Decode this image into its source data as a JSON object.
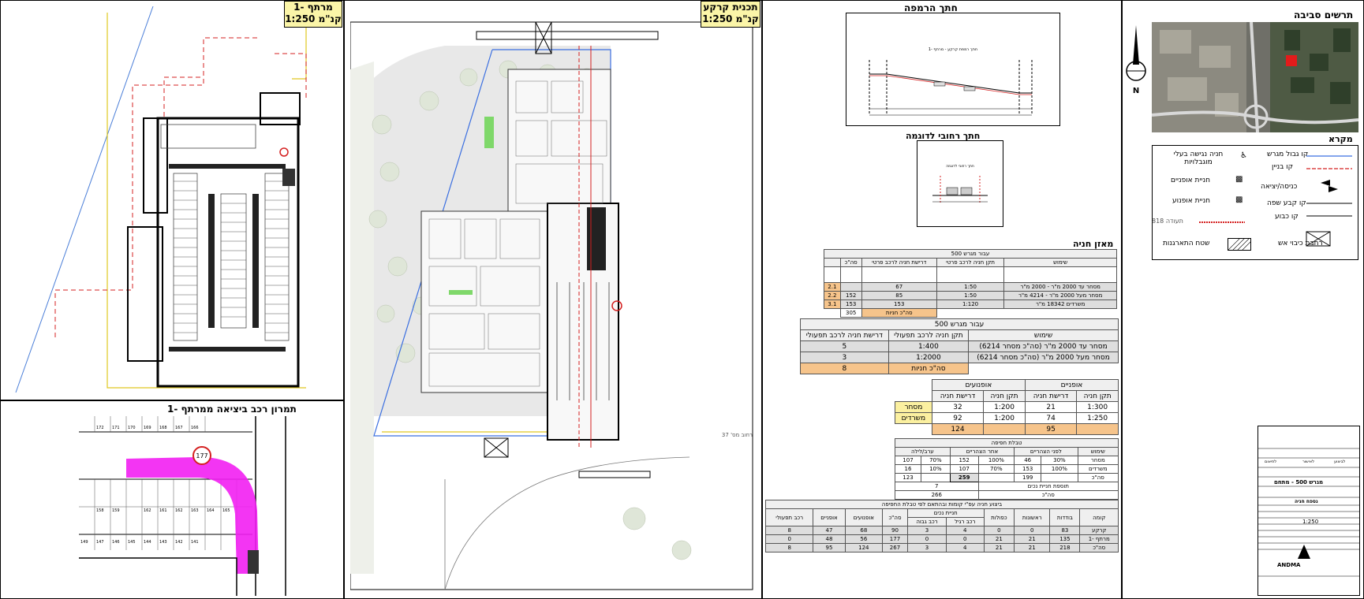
{
  "panels": {
    "basement_plan": {
      "title_line1": "מרתף -1",
      "title_line2": "קנ\"מ 1:250"
    },
    "ground_plan": {
      "title_line1": "תכנית קרקע",
      "title_line2": "קנ\"מ 1:250",
      "street_label": "רחוב מס' 37"
    },
    "turning": {
      "title": "תמרון רכב ביציאה ממרתף -1",
      "bay_numbers": [
        "172",
        "171",
        "170",
        "169",
        "168",
        "167",
        "166",
        "158",
        "159",
        "162",
        "161",
        "162",
        "163",
        "164",
        "165",
        "149",
        "147",
        "146",
        "145",
        "144",
        "143",
        "142",
        "141"
      ],
      "circle_label": "177"
    },
    "ramp_section": {
      "title": "חתך הרמפה",
      "inner_label": "חתך רמפת קרקע - מרתף -1"
    },
    "street_section": {
      "title": "חתך רחובי לדוגמה",
      "inner_label": "חתך רחובי לדוגמה"
    },
    "environs": {
      "title": "תרשים סביבה"
    }
  },
  "legend": {
    "title": "מקרא",
    "items": [
      {
        "label": "קו גבול מגרש",
        "color": "#3b6fe0"
      },
      {
        "label": "קו בניין",
        "color": "#d42020"
      },
      {
        "label": "כניסה/יציאה",
        "color": "#000000"
      },
      {
        "label": "קו קבע שפה",
        "color": "#000000"
      },
      {
        "label": "קו כבוע",
        "color": "#000000"
      },
      {
        "label": "חניה נגישה בעלי מוגבלויות",
        "color": "#000000"
      },
      {
        "label": "חניית אופניים",
        "color": "#000000"
      },
      {
        "label": "חניית אופנוע",
        "color": "#000000"
      },
      {
        "label": "תעודה 818",
        "color": "#d42020"
      },
      {
        "label": "רחבת כיבוי אש",
        "color": "#000000"
      },
      {
        "label": "שטח התארגנות",
        "color": "#000000"
      }
    ]
  },
  "parking_balance": {
    "title": "מאזן חניה",
    "table1": {
      "caption": "עבור מגרש 500",
      "headers": [
        "שימוש",
        "תקן חניה לרכב פרטי",
        "דרישת חניה לרכב פרטי",
        "סה\"כ"
      ],
      "rows": [
        {
          "use": "מסחר עד 2000 מ\"ר - 2000 מ\"ר",
          "norm": "1:50",
          "req": "67",
          "total": "",
          "code": "2.1"
        },
        {
          "use": "מסחר מעל 2000 מ\"ר - 4214 מ\"ר",
          "norm": "1:50",
          "req": "85",
          "total": "152",
          "code": "2.2"
        },
        {
          "use": "משרדים 18342 מ\"ר",
          "norm": "1:120",
          "req": "153",
          "total": "153",
          "code": "3.1"
        }
      ],
      "sum_label": "סה\"כ חניות",
      "sum_value": "305"
    },
    "table2": {
      "caption": "עבור מגרש 500",
      "headers": [
        "שימוש",
        "תקן חניה לרכב תפעולי",
        "דרישת חניה לרכב תפעולי"
      ],
      "rows": [
        {
          "use": "מסחר עד 2000 מ\"ר (סה\"כ מסחר 6214)",
          "norm": "1:400",
          "req": "5"
        },
        {
          "use": "מסחר מעל 2000 מ\"ר (סה\"כ מסחר 6214)",
          "norm": "1:2000",
          "req": "3"
        }
      ],
      "sum_label": "סה\"כ חניות",
      "sum_value": "8"
    },
    "table3": {
      "group_bikes": "אופניים",
      "group_moto": "אופנועים",
      "headers": [
        "תקן חניה",
        "דרישת חניה",
        "תקן חניה",
        "דרישת חניה"
      ],
      "rows": [
        {
          "label": "מסחר",
          "b_norm": "1:300",
          "b_req": "21",
          "m_norm": "1:200",
          "m_req": "32"
        },
        {
          "label": "משרדים",
          "b_norm": "1:250",
          "b_req": "74",
          "m_norm": "1:200",
          "m_req": "92"
        },
        {
          "label": "סה\"כ",
          "b_norm": "",
          "b_req": "95",
          "m_norm": "",
          "m_req": "124"
        }
      ]
    },
    "table4": {
      "caption": "טבלת חפיפה",
      "groups": [
        "שימוש",
        "לפני הצהריים",
        "אחר הצהריים",
        "ערב/לילה"
      ],
      "rows": [
        [
          "מסחר",
          "30%",
          "46",
          "100%",
          "152",
          "70%",
          "107"
        ],
        [
          "משרדים",
          "100%",
          "153",
          "70%",
          "107",
          "10%",
          "16"
        ],
        [
          "סה\"כ",
          "",
          "199",
          "",
          "259",
          "",
          "123"
        ]
      ],
      "extra1_label": "תוספת חניית נכים",
      "extra1_value": "7",
      "extra2_label": "סה\"כ",
      "extra2_value": "266"
    },
    "table5": {
      "caption": "ביצוע חניה עפ\"י קומות ובהתאם לפי טבלת החפיפה",
      "subgroup": "חניית נכים",
      "headers": [
        "קומה",
        "בודדות",
        "ראשונות",
        "כפולות",
        "רכב רגיל",
        "רכב גבוה",
        "סה\"כ",
        "אופנועים",
        "אופניים",
        "רכב תפעולי"
      ],
      "rows": [
        [
          "קרקע",
          "83",
          "0",
          "0",
          "4",
          "3",
          "90",
          "68",
          "47",
          "8"
        ],
        [
          "מרתף -1",
          "135",
          "21",
          "21",
          "0",
          "0",
          "177",
          "56",
          "48",
          "0"
        ],
        [
          "סה\"כ",
          "218",
          "21",
          "21",
          "4",
          "3",
          "267",
          "124",
          "95",
          "8"
        ]
      ]
    }
  },
  "title_block": {
    "firm": "ANDMA",
    "project": "מגרש 500 - מתחם",
    "sheet": "נספח חניה",
    "scale": "1:250",
    "options": [
      "לביצוע",
      "לאישור",
      "לתיאום"
    ]
  }
}
